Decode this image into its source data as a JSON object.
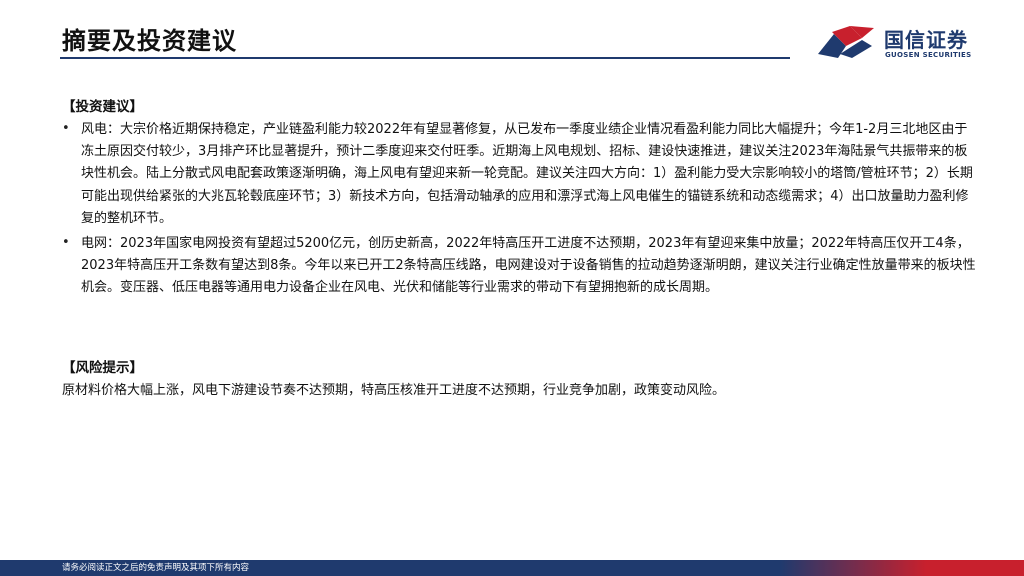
{
  "header": {
    "title": "摘要及投资建议",
    "brand_cn": "国信证券",
    "brand_en": "GUOSEN SECURITIES"
  },
  "investment": {
    "heading": "【投资建议】",
    "items": [
      {
        "bullet": "•",
        "text": "风电：大宗价格近期保持稳定，产业链盈利能力较2022年有望显著修复，从已发布一季度业绩企业情况看盈利能力同比大幅提升；今年1-2月三北地区由于冻土原因交付较少，3月排产环比显著提升，预计二季度迎来交付旺季。近期海上风电规划、招标、建设快速推进，建议关注2023年海陆景气共振带来的板块性机会。陆上分散式风电配套政策逐渐明确，海上风电有望迎来新一轮竞配。建议关注四大方向：1）盈利能力受大宗影响较小的塔筒/管桩环节；2）长期可能出现供给紧张的大兆瓦轮毂底座环节；3）新技术方向，包括滑动轴承的应用和漂浮式海上风电催生的锚链系统和动态缆需求；4）出口放量助力盈利修复的整机环节。"
      },
      {
        "bullet": "•",
        "text": "电网：2023年国家电网投资有望超过5200亿元，创历史新高，2022年特高压开工进度不达预期，2023年有望迎来集中放量；2022年特高压仅开工4条，2023年特高压开工条数有望达到8条。今年以来已开工2条特高压线路，电网建设对于设备销售的拉动趋势逐渐明朗，建议关注行业确定性放量带来的板块性机会。变压器、低压电器等通用电力设备企业在风电、光伏和储能等行业需求的带动下有望拥抱新的成长周期。"
      }
    ]
  },
  "risk": {
    "heading": "【风险提示】",
    "text": "原材料价格大幅上涨，风电下游建设节奏不达预期，特高压核准开工进度不达预期，行业竞争加剧，政策变动风险。"
  },
  "footer": {
    "disclaimer": "请务必阅读正文之后的免责声明及其项下所有内容"
  },
  "colors": {
    "brand_navy": "#1f3a6e",
    "brand_red": "#c8202d"
  }
}
